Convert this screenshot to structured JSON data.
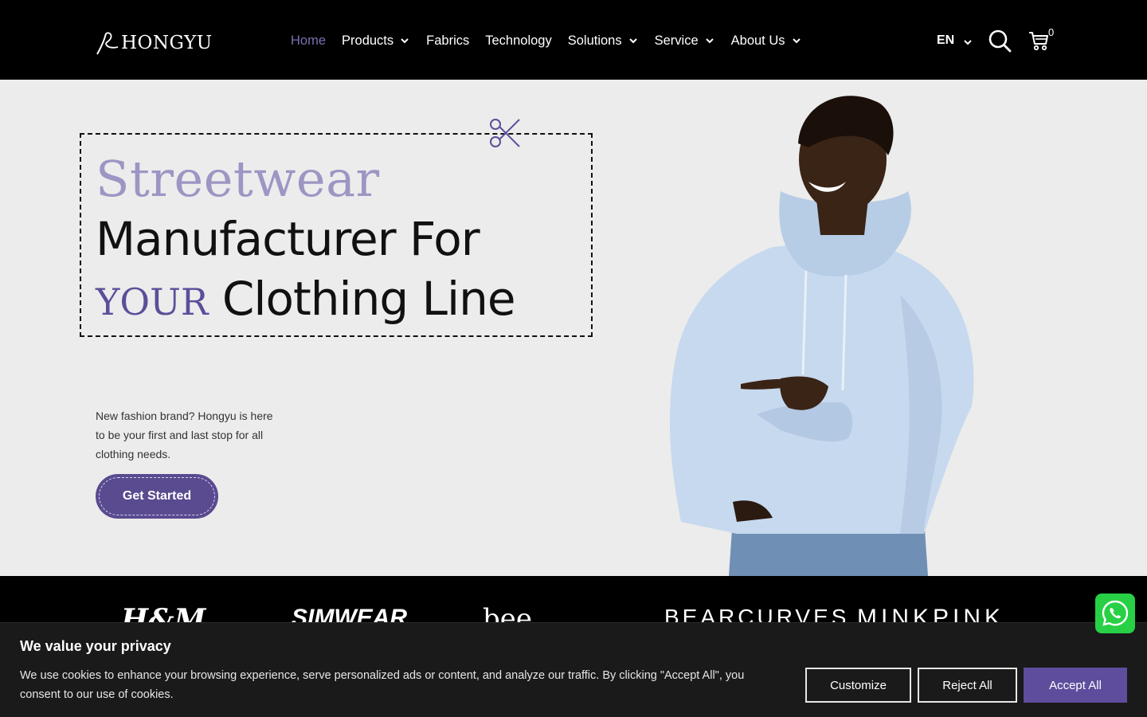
{
  "header": {
    "logo_text": "HONGYU",
    "nav": [
      {
        "label": "Home",
        "active": true,
        "dropdown": false
      },
      {
        "label": "Products",
        "active": false,
        "dropdown": true
      },
      {
        "label": "Fabrics",
        "active": false,
        "dropdown": false
      },
      {
        "label": "Technology",
        "active": false,
        "dropdown": false
      },
      {
        "label": "Solutions",
        "active": false,
        "dropdown": true
      },
      {
        "label": "Service",
        "active": false,
        "dropdown": true
      },
      {
        "label": "About Us",
        "active": false,
        "dropdown": true
      }
    ],
    "language": "EN",
    "cart_count": "0"
  },
  "hero": {
    "line1": "Streetwear",
    "line2": "Manufacturer For",
    "line3_accent": "YOUR",
    "line3_rest": "Clothing Line",
    "description": "New fashion brand? Hongyu is here to be your first and last stop for all clothing needs.",
    "cta_label": "Get Started"
  },
  "brands": [
    "H&M",
    "SIMWEAR",
    "bee",
    "BEARCURVES",
    "MINKPINK"
  ],
  "cookie": {
    "title": "We value your privacy",
    "text": "We use cookies to enhance your browsing experience, serve personalized ads or content, and analyze our traffic. By clicking \"Accept All\", you consent to our use of cookies.",
    "customize_label": "Customize",
    "reject_label": "Reject All",
    "accept_label": "Accept All"
  },
  "colors": {
    "accent": "#5a4a8f",
    "accent_light": "#9e95c4",
    "nav_active": "#7b6fb0",
    "header_bg": "#000000",
    "hero_bg": "#ececec",
    "whatsapp": "#27d045"
  },
  "icons": {
    "search": "search-icon",
    "cart": "cart-icon",
    "scissors": "scissors-icon",
    "whatsapp": "whatsapp-icon",
    "chevron": "chevron-down-icon"
  }
}
